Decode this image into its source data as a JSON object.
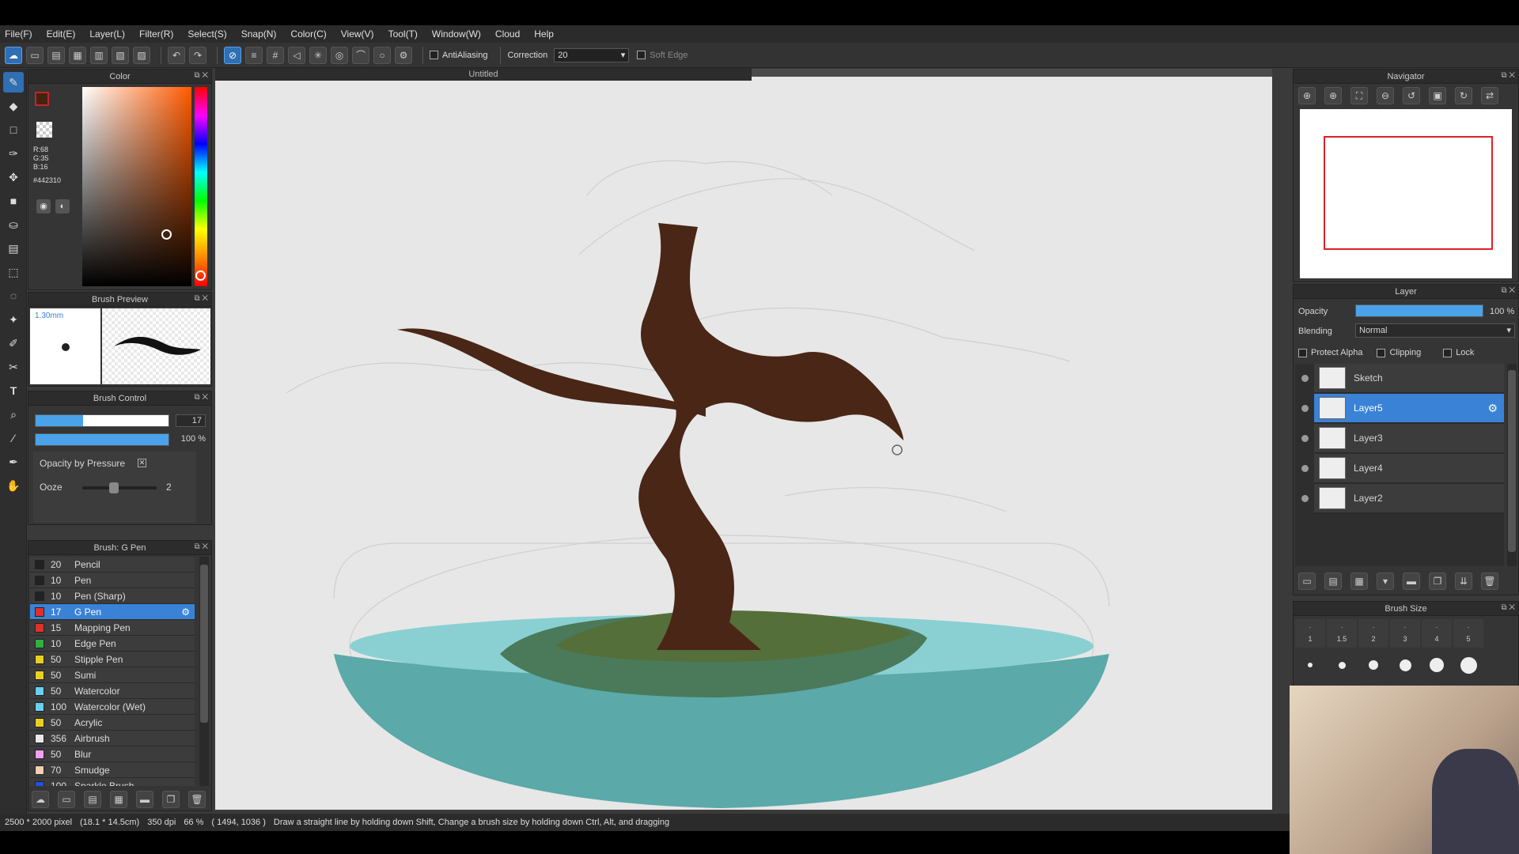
{
  "menu": [
    "File(F)",
    "Edit(E)",
    "Layer(L)",
    "Filter(R)",
    "Select(S)",
    "Snap(N)",
    "Color(C)",
    "View(V)",
    "Tool(T)",
    "Window(W)",
    "Cloud",
    "Help"
  ],
  "toolbar": {
    "antialiasing_label": "AntiAliasing",
    "correction_label": "Correction",
    "correction_value": "20",
    "soft_edge_label": "Soft Edge"
  },
  "document": {
    "title": "Untitled"
  },
  "color_panel": {
    "title": "Color",
    "r": "R:68",
    "g": "G:35",
    "b": "B:16",
    "hex": "#442310",
    "fg_color": "#c0262a",
    "bg_color": "#1e6fbf",
    "picked_color": "#442310"
  },
  "brush_preview": {
    "title": "Brush Preview",
    "size": "1.30mm"
  },
  "brush_control": {
    "title": "Brush Control",
    "size_value": "17",
    "opacity_value": "100 %",
    "opacity_by_pressure": "Opacity by Pressure",
    "ooze_label": "Ooze",
    "ooze_value": "2"
  },
  "brush_list": {
    "title": "Brush: G Pen",
    "items": [
      {
        "size": "20",
        "name": "Pencil",
        "color": "#222"
      },
      {
        "size": "10",
        "name": "Pen",
        "color": "#222"
      },
      {
        "size": "10",
        "name": "Pen (Sharp)",
        "color": "#222"
      },
      {
        "size": "17",
        "name": "G Pen",
        "color": "#e0302a"
      },
      {
        "size": "15",
        "name": "Mapping Pen",
        "color": "#e0302a"
      },
      {
        "size": "10",
        "name": "Edge Pen",
        "color": "#2fb040"
      },
      {
        "size": "50",
        "name": "Stipple Pen",
        "color": "#e8d020"
      },
      {
        "size": "50",
        "name": "Sumi",
        "color": "#e8d020"
      },
      {
        "size": "50",
        "name": "Watercolor",
        "color": "#6ad0f0"
      },
      {
        "size": "100",
        "name": "Watercolor (Wet)",
        "color": "#6ad0f0"
      },
      {
        "size": "50",
        "name": "Acrylic",
        "color": "#e8d020"
      },
      {
        "size": "356",
        "name": "Airbrush",
        "color": "#e8e8e8"
      },
      {
        "size": "50",
        "name": "Blur",
        "color": "#f0a0f0"
      },
      {
        "size": "70",
        "name": "Smudge",
        "color": "#f0d0b0"
      },
      {
        "size": "100",
        "name": "Sparkle Brush",
        "color": "#2050e0"
      }
    ]
  },
  "navigator": {
    "title": "Navigator"
  },
  "layer_panel": {
    "title": "Layer",
    "opacity_label": "Opacity",
    "opacity_value": "100 %",
    "opacity_fraction": 1.0,
    "blending_label": "Blending",
    "blending_value": "Normal",
    "protect_alpha": "Protect Alpha",
    "clipping": "Clipping",
    "lock": "Lock",
    "layers": [
      {
        "name": "Sketch"
      },
      {
        "name": "Layer5"
      },
      {
        "name": "Layer3"
      },
      {
        "name": "Layer4"
      },
      {
        "name": "Layer2"
      }
    ]
  },
  "brush_size_panel": {
    "title": "Brush Size",
    "sizes": [
      "1",
      "1.5",
      "2",
      "3",
      "4",
      "5"
    ]
  },
  "status": {
    "dimensions": "2500 * 2000 pixel",
    "physical": "(18.1 * 14.5cm)",
    "dpi": "350 dpi",
    "zoom": "66 %",
    "cursor": "( 1494, 1036 )",
    "hint": "Draw a straight line by holding down Shift, Change a brush size by holding down Ctrl, Alt, and dragging"
  }
}
